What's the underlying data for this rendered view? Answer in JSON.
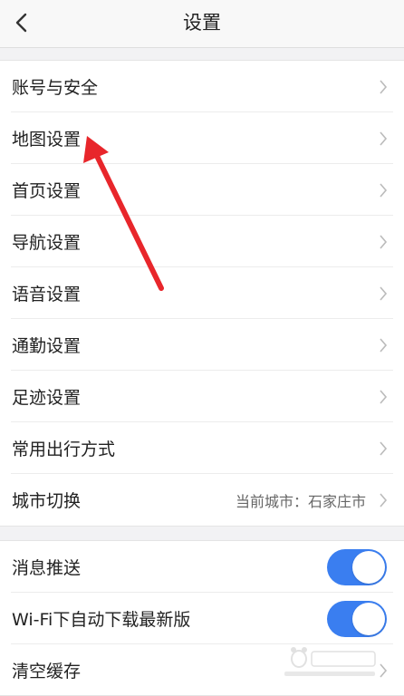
{
  "header": {
    "title": "设置",
    "back_icon": "chevron-left-icon"
  },
  "group1": {
    "items": [
      {
        "label": "账号与安全"
      },
      {
        "label": "地图设置"
      },
      {
        "label": "首页设置"
      },
      {
        "label": "导航设置"
      },
      {
        "label": "语音设置"
      },
      {
        "label": "通勤设置"
      },
      {
        "label": "足迹设置"
      },
      {
        "label": "常用出行方式"
      },
      {
        "label": "城市切换",
        "value": "当前城市：石家庄市"
      }
    ]
  },
  "group2": {
    "items": [
      {
        "label": "消息推送",
        "toggle_on": true
      },
      {
        "label": "Wi-Fi下自动下载最新版",
        "toggle_on": true
      },
      {
        "label": "清空缓存"
      }
    ]
  },
  "colors": {
    "accent": "#3a7ef0",
    "annotation": "#e8262b",
    "background": "#f2f2f4"
  }
}
